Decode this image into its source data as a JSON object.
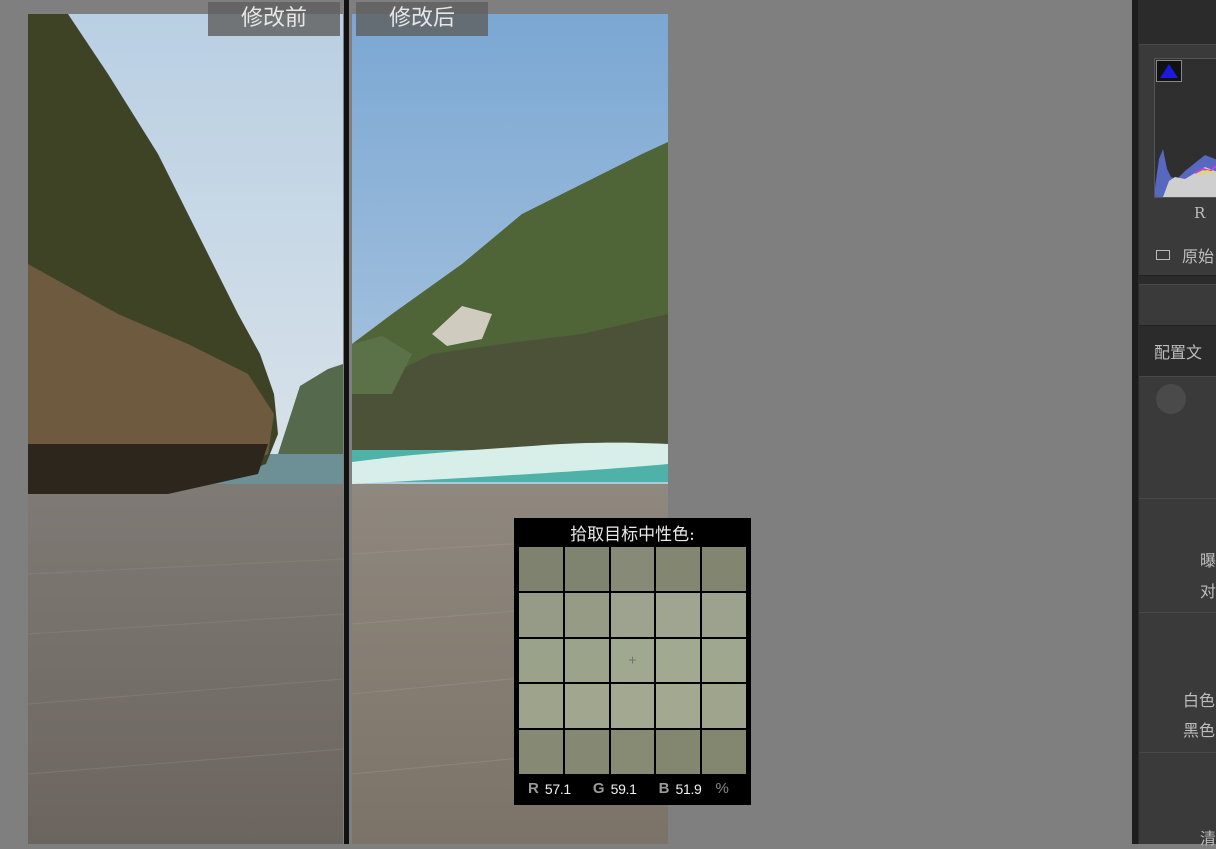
{
  "compare": {
    "before_label": "修改前",
    "after_label": "修改后"
  },
  "loupe": {
    "title": "拾取目标中性色:",
    "crosshair": "+",
    "swatches": [
      [
        "#7e826f",
        "#7f8470",
        "#868a77",
        "#838771",
        "#828671"
      ],
      [
        "#959b86",
        "#959b85",
        "#9da38f",
        "#9fa590",
        "#9ca28d"
      ],
      [
        "#9aa28a",
        "#9ba38b",
        "#a0a890",
        "#a2a991",
        "#a0a78f"
      ],
      [
        "#9ea48c",
        "#a1a78f",
        "#a3a991",
        "#a2a990",
        "#9fa48d"
      ],
      [
        "#868a74",
        "#858973",
        "#878b74",
        "#84876f",
        "#848770"
      ]
    ],
    "r_label": "R",
    "r_value": "57.1",
    "g_label": "G",
    "g_value": "59.1",
    "b_label": "B",
    "b_value": "51.9",
    "unit": "%"
  },
  "panel": {
    "histogram_channel": "R",
    "original_photo": "原始",
    "profile_label": "配置文",
    "exposure_label": "曝",
    "contrast_label": "对",
    "whites_label": "白色",
    "blacks_label": "黑色",
    "clarity_label": "清"
  }
}
